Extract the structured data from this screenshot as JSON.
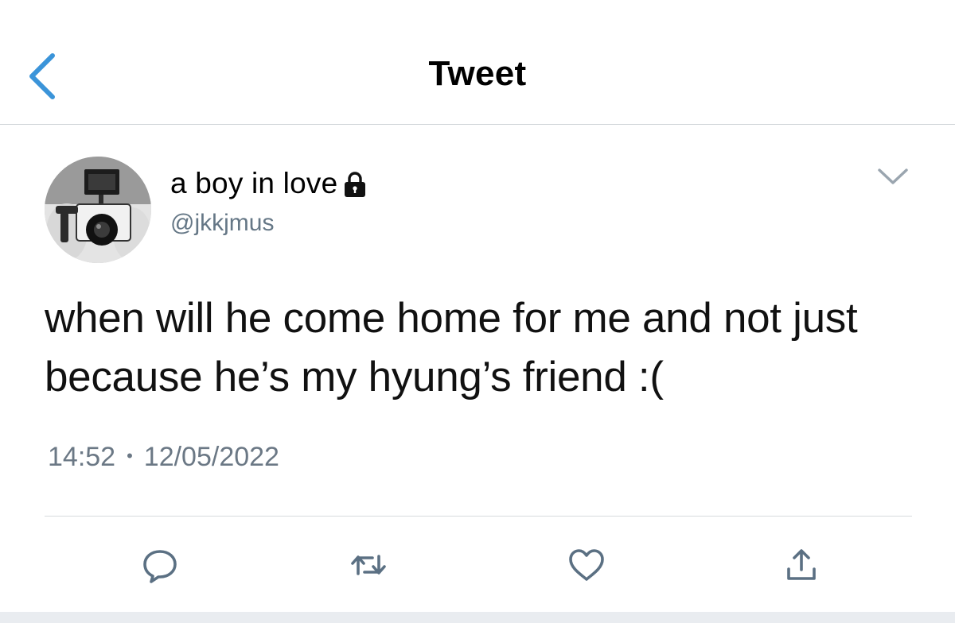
{
  "header": {
    "title": "Tweet",
    "back_icon": "chevron-left-icon"
  },
  "tweet": {
    "author": {
      "display_name": "a boy in love",
      "handle": "@jkkjmus",
      "protected_icon": "lock-icon",
      "avatar": "camera-photo-avatar"
    },
    "text": "when will he come home for me and not just because he’s my hyung’s friend :(",
    "time": "14:52",
    "separator": "•",
    "date": "12/05/2022"
  },
  "actions": [
    {
      "name": "reply",
      "icon": "reply-bubble-icon"
    },
    {
      "name": "retweet",
      "icon": "retweet-icon"
    },
    {
      "name": "like",
      "icon": "heart-icon"
    },
    {
      "name": "share",
      "icon": "share-icon"
    }
  ],
  "colors": {
    "accent": "#3b94d9",
    "secondary_text": "#657786",
    "icon_gray": "#5b7083",
    "divider": "#d6dadd"
  }
}
